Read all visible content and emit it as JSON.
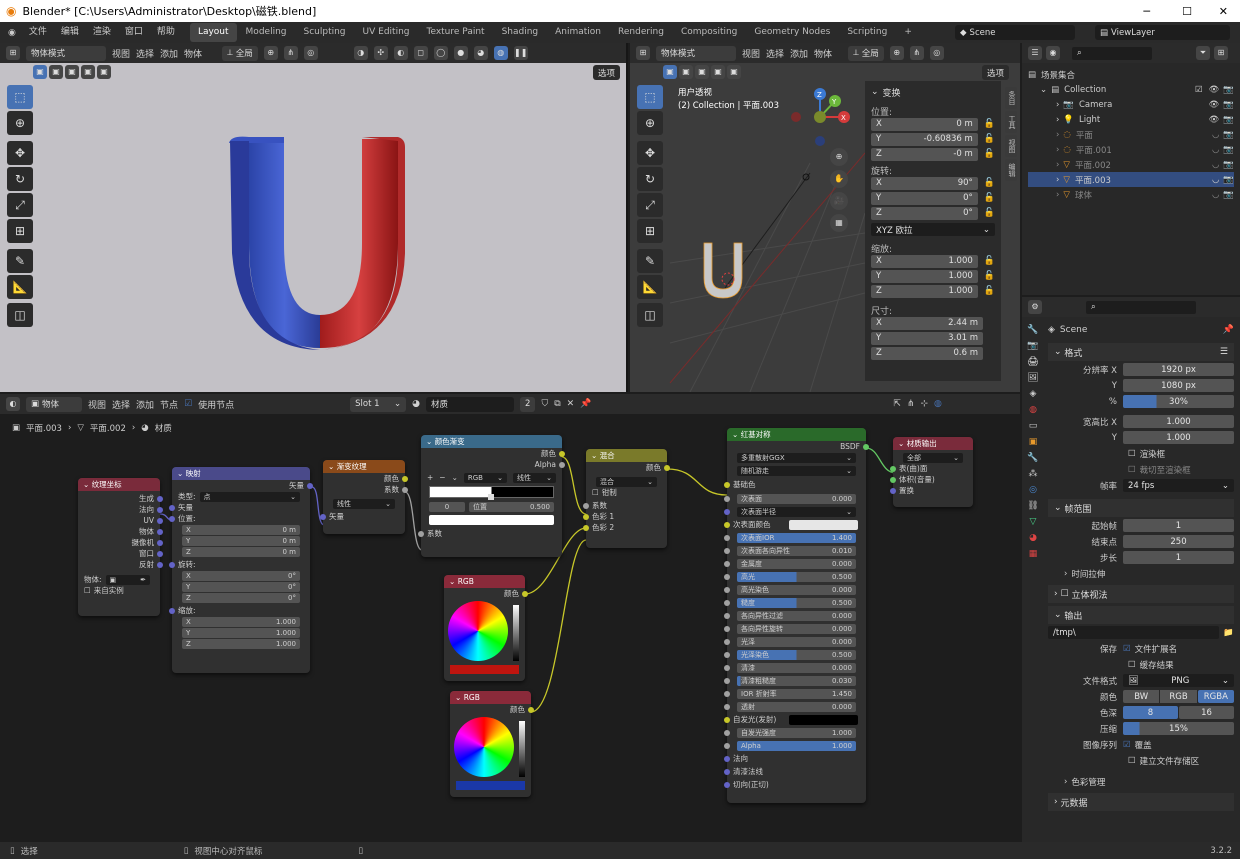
{
  "window": {
    "title": "Blender* [C:\\Users\\Administrator\\Desktop\\磁铁.blend]",
    "min": "─",
    "max": "☐",
    "close": "✕"
  },
  "menus": [
    "文件",
    "编辑",
    "渲染",
    "窗口",
    "帮助"
  ],
  "workspaces": [
    "Layout",
    "Modeling",
    "Sculpting",
    "UV Editing",
    "Texture Paint",
    "Shading",
    "Animation",
    "Rendering",
    "Compositing",
    "Geometry Nodes",
    "Scripting"
  ],
  "workspace_add": "+",
  "scene": {
    "label": "Scene",
    "viewlayer": "ViewLayer"
  },
  "viewport_left": {
    "mode": "物体模式",
    "menus": [
      "视图",
      "选择",
      "添加",
      "物体"
    ],
    "transform": "全局",
    "options": "选项"
  },
  "viewport_right": {
    "mode": "物体模式",
    "menus": [
      "视图",
      "选择",
      "添加",
      "物体"
    ],
    "transform": "全局",
    "options": "选项",
    "overlay_title": "用户透视",
    "overlay_sub": "(2) Collection | 平面.003",
    "axes": {
      "x": "X",
      "y": "Y",
      "z": "Z"
    }
  },
  "transform_panel": {
    "title": "变换",
    "location_label": "位置:",
    "location": [
      {
        "axis": "X",
        "value": "0 m"
      },
      {
        "axis": "Y",
        "value": "-0.60836 m"
      },
      {
        "axis": "Z",
        "value": "-0 m"
      }
    ],
    "rotation_label": "旋转:",
    "rotation": [
      {
        "axis": "X",
        "value": "90°"
      },
      {
        "axis": "Y",
        "value": "0°"
      },
      {
        "axis": "Z",
        "value": "0°"
      }
    ],
    "rotation_mode": "XYZ 欧拉",
    "scale_label": "缩放:",
    "scale": [
      {
        "axis": "X",
        "value": "1.000"
      },
      {
        "axis": "Y",
        "value": "1.000"
      },
      {
        "axis": "Z",
        "value": "1.000"
      }
    ],
    "dimensions_label": "尺寸:",
    "dimensions": [
      {
        "axis": "X",
        "value": "2.44 m"
      },
      {
        "axis": "Y",
        "value": "3.01 m"
      },
      {
        "axis": "Z",
        "value": "0.6 m"
      }
    ]
  },
  "sidebar_tabs": [
    "条目",
    "工具",
    "视图",
    "编辑"
  ],
  "outliner": {
    "root": "场景集合",
    "collection": "Collection",
    "items": [
      "Camera",
      "Light",
      "平面",
      "平面.001",
      "平面.002",
      "平面.003",
      "球体"
    ]
  },
  "properties": {
    "scene_name": "Scene",
    "format": {
      "title": "格式",
      "res_x_label": "分辨率 X",
      "res_x": "1920 px",
      "res_y_label": "Y",
      "res_y": "1080 px",
      "pct_label": "%",
      "pct": "30%",
      "aspect_x_label": "宽高比 X",
      "aspect_x": "1.000",
      "aspect_y_label": "Y",
      "aspect_y": "1.000",
      "border": "渲染框",
      "crop": "裁切至渲染框",
      "fps_label": "帧率",
      "fps": "24 fps"
    },
    "frame_range": {
      "title": "帧范围",
      "start_label": "起始帧",
      "start": "1",
      "end_label": "结束点",
      "end": "250",
      "step_label": "步长",
      "step": "1",
      "time_stretch": "时间拉伸"
    },
    "stereo": "立体视法",
    "output": {
      "title": "输出",
      "path": "/tmp\\",
      "save_label": "保存",
      "ext": "文件扩展名",
      "cache": "缓存结果",
      "format_label": "文件格式",
      "format": "PNG",
      "color_label": "颜色",
      "color_opts": [
        "BW",
        "RGB",
        "RGBA"
      ],
      "depth_label": "色深",
      "depth_opts": [
        "8",
        "16"
      ],
      "compress_label": "压缩",
      "compress": "15%",
      "seq_label": "图像序列",
      "overwrite": "覆盖",
      "placeholders": "建立文件存储区",
      "color_mgmt": "色彩管理"
    },
    "metadata": "元数据"
  },
  "node_editor": {
    "header": {
      "type": "物体",
      "menus": [
        "视图",
        "选择",
        "添加",
        "节点"
      ],
      "use_nodes": "使用节点",
      "slot": "Slot 1",
      "material": "材质",
      "users": "2"
    },
    "breadcrumb": [
      "平面.003",
      "平面.002",
      "材质"
    ],
    "tex_coord": {
      "title": "纹理坐标",
      "outputs": [
        "生成",
        "法向",
        "UV",
        "物体",
        "摄像机",
        "窗口",
        "反射"
      ],
      "object_label": "物体:",
      "from_instancer": "来自实例"
    },
    "mapping": {
      "title": "映射",
      "output": "矢量",
      "type_label": "类型:",
      "type": "点",
      "input_vec": "矢量",
      "location_label": "位置:",
      "loc": [
        {
          "axis": "X",
          "value": "0 m"
        },
        {
          "axis": "Y",
          "value": "0 m"
        },
        {
          "axis": "Z",
          "value": "0 m"
        }
      ],
      "rotation_label": "旋转:",
      "rot": [
        {
          "axis": "X",
          "value": "0°"
        },
        {
          "axis": "Y",
          "value": "0°"
        },
        {
          "axis": "Z",
          "value": "0°"
        }
      ],
      "scale_label": "缩放:",
      "scl": [
        {
          "axis": "X",
          "value": "1.000"
        },
        {
          "axis": "Y",
          "value": "1.000"
        },
        {
          "axis": "Z",
          "value": "1.000"
        }
      ]
    },
    "gradient": {
      "title": "渐变纹理",
      "out_color": "颜色",
      "out_fac": "系数",
      "type": "线性",
      "input": "矢量"
    },
    "ramp": {
      "title": "颜色渐变",
      "out_color": "颜色",
      "out_alpha": "Alpha",
      "mode": "RGB",
      "interp": "线性",
      "index": "0",
      "pos_label": "位置",
      "pos": "0.500",
      "input": "系数"
    },
    "mix": {
      "title": "混合",
      "out": "颜色",
      "blend": "混合",
      "clamp": "钳制",
      "fac": "系数",
      "c1": "色彩 1",
      "c2": "色彩 2"
    },
    "rgb1": {
      "title": "RGB",
      "out": "颜色",
      "swatch": "#c0150f"
    },
    "rgb2": {
      "title": "RGB",
      "out": "颜色",
      "swatch": "#1a38a8"
    },
    "bsdf": {
      "title": "红基对称",
      "out": "BSDF",
      "dist": "多重散射GGX",
      "sss_method": "随机游走",
      "base_color": "基础色",
      "rows": [
        {
          "label": "次表面",
          "value": "0.000",
          "fill": 0
        },
        {
          "label": "次表面半径",
          "value": "",
          "fill": 0
        },
        {
          "label": "次表面颜色",
          "value": "",
          "fill": 0
        },
        {
          "label": "次表面IOR",
          "value": "1.400",
          "fill": 1
        },
        {
          "label": "次表面各向异性",
          "value": "0.010",
          "fill": 0
        },
        {
          "label": "金属度",
          "value": "0.000",
          "fill": 0
        },
        {
          "label": "高光",
          "value": "0.500",
          "fill": 0.5
        },
        {
          "label": "高光染色",
          "value": "0.000",
          "fill": 0
        },
        {
          "label": "糙度",
          "value": "0.500",
          "fill": 0.5
        },
        {
          "label": "各向异性过滤",
          "value": "0.000",
          "fill": 0
        },
        {
          "label": "各向异性旋转",
          "value": "0.000",
          "fill": 0
        },
        {
          "label": "光泽",
          "value": "0.000",
          "fill": 0
        },
        {
          "label": "光泽染色",
          "value": "0.500",
          "fill": 0.5
        },
        {
          "label": "清漆",
          "value": "0.000",
          "fill": 0
        },
        {
          "label": "清漆粗糙度",
          "value": "0.030",
          "fill": 0.03
        },
        {
          "label": "IOR 折射率",
          "value": "1.450",
          "fill": 0
        },
        {
          "label": "透射",
          "value": "0.000",
          "fill": 0
        },
        {
          "label": "自发光(发射)",
          "value": "",
          "fill": 0
        },
        {
          "label": "自发光强度",
          "value": "1.000",
          "fill": 0
        },
        {
          "label": "Alpha",
          "value": "1.000",
          "fill": 1
        }
      ],
      "tail": [
        "法向",
        "清漆法线",
        "切向(正切)"
      ]
    },
    "output": {
      "title": "材质输出",
      "target": "全部",
      "inputs": [
        "表(曲)面",
        "体积(音量)",
        "置换"
      ]
    }
  },
  "statusbar": {
    "left": "选择",
    "mid": "视图中心对齐鼠标",
    "version": "3.2.2"
  }
}
